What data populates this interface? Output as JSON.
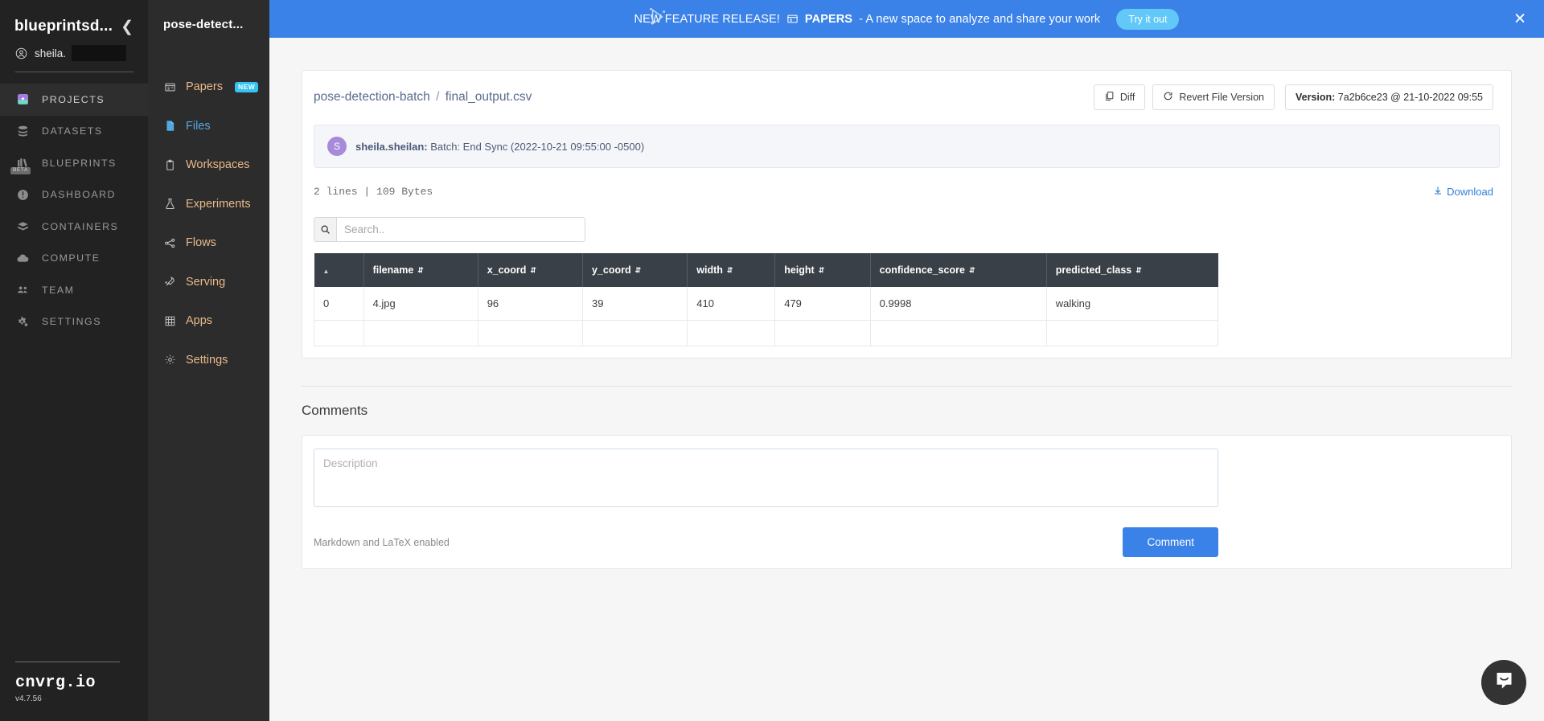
{
  "sidebar": {
    "org_name": "blueprintsd...",
    "user_name": "sheila.",
    "collapse_icon": "chevron-left-icon",
    "items": [
      {
        "label": "PROJECTS",
        "icon": "projects-icon",
        "active": true
      },
      {
        "label": "DATASETS",
        "icon": "datasets-icon",
        "active": false
      },
      {
        "label": "BLUEPRINTS",
        "icon": "blueprints-icon",
        "active": false,
        "tag": "BETA"
      },
      {
        "label": "DASHBOARD",
        "icon": "dashboard-icon",
        "active": false
      },
      {
        "label": "CONTAINERS",
        "icon": "containers-icon",
        "active": false
      },
      {
        "label": "COMPUTE",
        "icon": "compute-icon",
        "active": false
      },
      {
        "label": "TEAM",
        "icon": "team-icon",
        "active": false
      },
      {
        "label": "SETTINGS",
        "icon": "settings-icon",
        "active": false
      }
    ],
    "brand": "cnvrg.io",
    "version": "v4.7.56"
  },
  "project_nav": {
    "title": "pose-detect...",
    "items": [
      {
        "label": "Papers",
        "icon": "papers-icon",
        "badge": "NEW",
        "active": false
      },
      {
        "label": "Files",
        "icon": "file-icon",
        "active": true
      },
      {
        "label": "Workspaces",
        "icon": "workspaces-icon",
        "active": false
      },
      {
        "label": "Experiments",
        "icon": "flask-icon",
        "active": false
      },
      {
        "label": "Flows",
        "icon": "flows-icon",
        "active": false
      },
      {
        "label": "Serving",
        "icon": "rocket-icon",
        "active": false
      },
      {
        "label": "Apps",
        "icon": "grid-icon",
        "active": false
      },
      {
        "label": "Settings",
        "icon": "gear-icon",
        "active": false
      }
    ]
  },
  "banner": {
    "lead": "NEW FEATURE RELEASE!",
    "product": "PAPERS",
    "tail": "- A new space to analyze and share your work",
    "cta": "Try it out",
    "close_icon": "close-icon",
    "bg_color": "#3b82e8",
    "cta_color": "#61c8f7"
  },
  "file_header": {
    "breadcrumb_project": "pose-detection-batch",
    "breadcrumb_sep": "/",
    "breadcrumb_file": "final_output.csv",
    "diff_label": "Diff",
    "revert_label": "Revert File Version",
    "version_prefix": "Version:",
    "version_value": "7a2b6ce23 @ 21-10-2022 09:55"
  },
  "commit": {
    "avatar_initial": "S",
    "author": "sheila.sheilan:",
    "message": " Batch: End Sync (2022-10-21 09:55:00 -0500)"
  },
  "file_meta": {
    "stats": "2 lines | 109 Bytes",
    "download_label": "Download",
    "download_icon": "download-icon"
  },
  "search": {
    "placeholder": "Search..",
    "value": "",
    "icon": "search-icon"
  },
  "table": {
    "columns": [
      "",
      "filename",
      "x_coord",
      "y_coord",
      "width",
      "height",
      "confidence_score",
      "predicted_class"
    ],
    "rows": [
      [
        "0",
        "4.jpg",
        "96",
        "39",
        "410",
        "479",
        "0.9998",
        "walking"
      ]
    ],
    "blank_row": true
  },
  "comments": {
    "title": "Comments",
    "placeholder": "Description",
    "value": "",
    "note": "Markdown and LaTeX enabled",
    "button": "Comment",
    "button_color": "#3b82e8"
  },
  "intercom": {
    "icon": "chat-bubble-icon"
  }
}
